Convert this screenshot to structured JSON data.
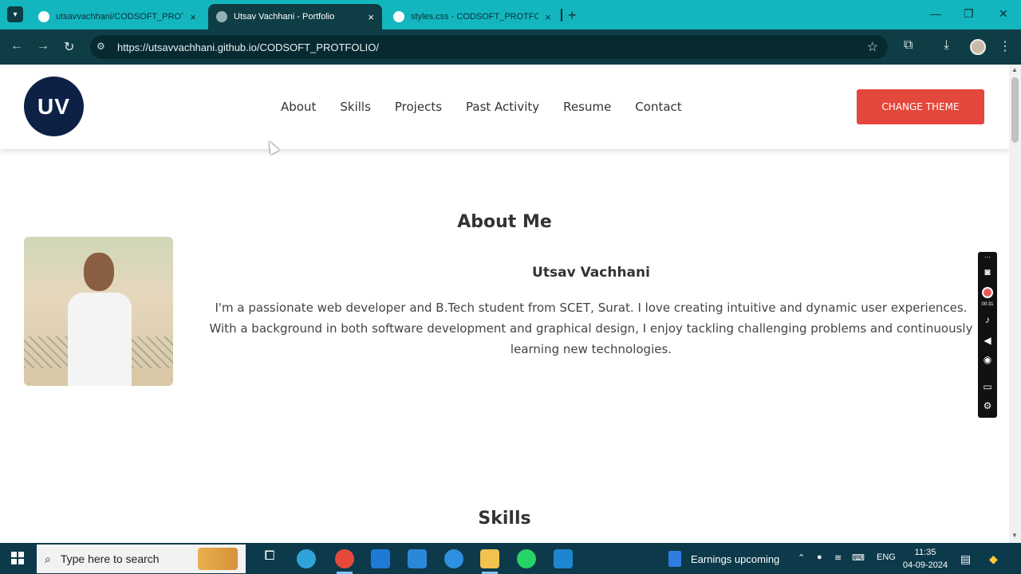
{
  "browser": {
    "tabs": [
      {
        "title": "utsavvachhani/CODSOFT_PROTF",
        "active": false
      },
      {
        "title": "Utsav Vachhani - Portfolio",
        "active": true
      },
      {
        "title": "styles.css - CODSOFT_PROTFO",
        "active": false
      }
    ],
    "url": "https://utsavvachhani.github.io/CODSOFT_PROTFOLIO/",
    "new_tab": "+",
    "close": "×"
  },
  "site": {
    "logo": "UV",
    "nav": [
      "About",
      "Skills",
      "Projects",
      "Past Activity",
      "Resume",
      "Contact"
    ],
    "theme_button": "CHANGE THEME",
    "about": {
      "title": "About Me",
      "name": "Utsav Vachhani",
      "text": "I'm a passionate web developer and B.Tech student from SCET, Surat. I love creating intuitive and dynamic user experiences. With a background in both software development and graphical design, I enjoy tackling challenging problems and continuously learning new technologies."
    },
    "skills_title": "Skills"
  },
  "recorder": {
    "time": "00:31"
  },
  "taskbar": {
    "search_placeholder": "Type here to search",
    "news": "Earnings upcoming",
    "lang": "ENG",
    "time": "11:35",
    "date": "04-09-2024"
  },
  "colors": {
    "tabbar": "#13b6bf",
    "toolbar": "#0f3d45",
    "logo_bg": "#0d2147",
    "theme_button": "#e4473b"
  }
}
